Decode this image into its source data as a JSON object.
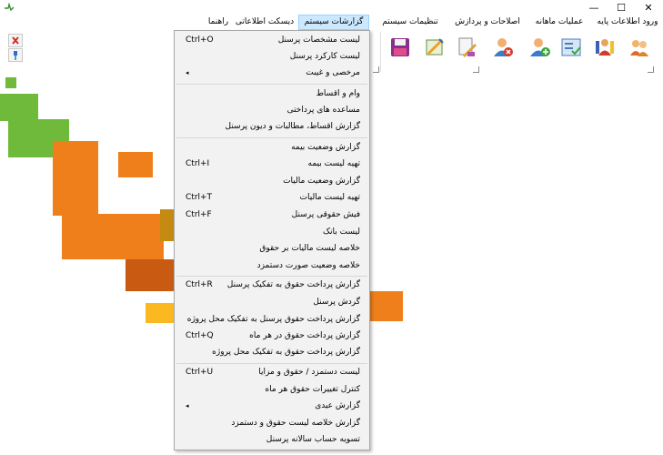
{
  "window": {
    "minimize_glyph": "—",
    "maximize_glyph": "☐",
    "close_glyph": "✕"
  },
  "menubar": [
    {
      "label": "ورود اطلاعات پایه"
    },
    {
      "label": "عملیات ماهانه"
    },
    {
      "label": "اصلاحات و پردازش"
    },
    {
      "label": "تنظیمات سیستم"
    },
    {
      "label": "گزارشات سیستم"
    },
    {
      "label": "دیسکت اطلاعاتی"
    },
    {
      "label": "راهنما"
    }
  ],
  "toolbar_icons": [
    "personnel-icon",
    "personnel-settings-icon",
    "checklist-icon",
    "add-user-icon",
    "remove-user-icon",
    "edit-document-icon",
    "report-icon",
    "save-disk-icon"
  ],
  "dropdown": {
    "items": [
      {
        "label": "لیست مشخصات پرسنل",
        "shortcut": "Ctrl+O"
      },
      {
        "label": "لیست کارکرد پرسنل",
        "shortcut": ""
      },
      {
        "label": "مرخصی و غیبت",
        "shortcut": "",
        "submenu": "◂"
      },
      {
        "label": "وام و اقساط",
        "shortcut": ""
      },
      {
        "label": "مساعده های پرداختی",
        "shortcut": ""
      },
      {
        "label": "گزارش اقساط، مطالبات و دیون پرسنل",
        "shortcut": ""
      },
      {
        "label": "گزارش وضعیت بیمه",
        "shortcut": ""
      },
      {
        "label": "تهیه لیست بیمه",
        "shortcut": "Ctrl+I"
      },
      {
        "label": "گزارش وضعیت مالیات",
        "shortcut": ""
      },
      {
        "label": "تهیه لیست مالیات",
        "shortcut": "Ctrl+T"
      },
      {
        "label": "فیش حقوقی پرسنل",
        "shortcut": "Ctrl+F"
      },
      {
        "label": "لیست بانک",
        "shortcut": ""
      },
      {
        "label": "خلاصه لیست مالیات بر حقوق",
        "shortcut": ""
      },
      {
        "label": "خلاصه وضعیت صورت دستمزد",
        "shortcut": ""
      },
      {
        "label": "گزارش پرداخت حقوق به تفکیک پرسنل",
        "shortcut": "Ctrl+R"
      },
      {
        "label": "گردش پرسنل",
        "shortcut": ""
      },
      {
        "label": "گزارش پرداخت حقوق پرسنل به تفکیک محل پروژه",
        "shortcut": ""
      },
      {
        "label": "گزارش پرداخت حقوق در هر ماه",
        "shortcut": "Ctrl+Q"
      },
      {
        "label": "گزارش پرداخت حقوق به تفکیک محل پروژه",
        "shortcut": ""
      },
      {
        "label": "لیست دستمزد / حقوق و مزایا",
        "shortcut": "Ctrl+U"
      },
      {
        "label": "کنترل تغییرات حقوق هر ماه",
        "shortcut": ""
      },
      {
        "label": "گزارش عیدی",
        "shortcut": "",
        "submenu": "◂"
      },
      {
        "label": "گزارش خلاصه لیست حقوق و دستمزد",
        "shortcut": ""
      },
      {
        "label": "تسویه حساب سالانه پرسنل",
        "shortcut": ""
      }
    ]
  },
  "colors": {
    "green": "#6fba3b",
    "orange": "#ef7f1a",
    "orange_dark": "#c95a12",
    "yellow": "#fbb820",
    "menu_highlight": "#cce8ff"
  }
}
